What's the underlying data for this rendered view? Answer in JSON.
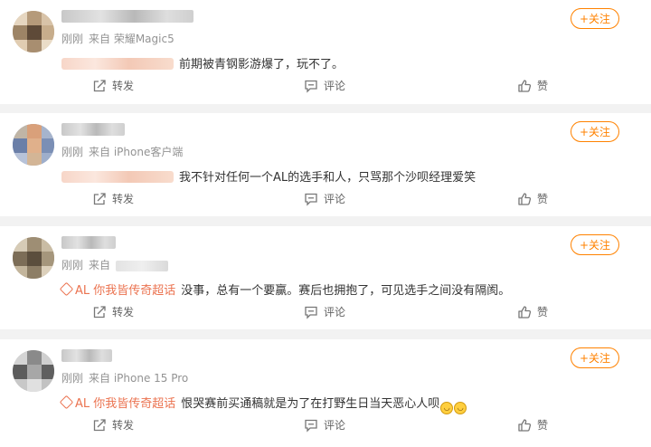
{
  "comments": [
    {
      "time": "刚刚",
      "source": "来自 荣耀Magic5",
      "source_blurred": false,
      "topic": "",
      "has_mention": true,
      "text": "前期被青钢影游爆了，玩不了。",
      "emoji_count": 0
    },
    {
      "time": "刚刚",
      "source": "来自 iPhone客户端",
      "source_blurred": false,
      "topic": "",
      "has_mention": true,
      "text": "我不针对任何一个AL的选手和人，只骂那个沙呗经理爱笑",
      "emoji_count": 0
    },
    {
      "time": "刚刚",
      "source": "来自",
      "source_blurred": true,
      "topic": "AL 你我皆传奇超话",
      "has_mention": false,
      "text": "没事，总有一个要赢。赛后也拥抱了，可见选手之间没有隔阂。",
      "emoji_count": 0
    },
    {
      "time": "刚刚",
      "source": "来自 iPhone 15 Pro",
      "source_blurred": false,
      "topic": "AL 你我皆传奇超话",
      "has_mention": false,
      "text": "恨哭赛前买通稿就是为了在打野生日当天恶心人呗",
      "emoji_count": 2
    }
  ],
  "labels": {
    "follow": "+关注",
    "repost": "转发",
    "comment": "评论",
    "like": "赞"
  },
  "colors": {
    "accent": "#ff8200",
    "topic": "#eb7350",
    "meta": "#939393"
  },
  "icons": {
    "repost": "share-icon",
    "comment": "comment-icon",
    "like": "thumbs-up-icon",
    "topic": "topic-diamond-icon"
  }
}
